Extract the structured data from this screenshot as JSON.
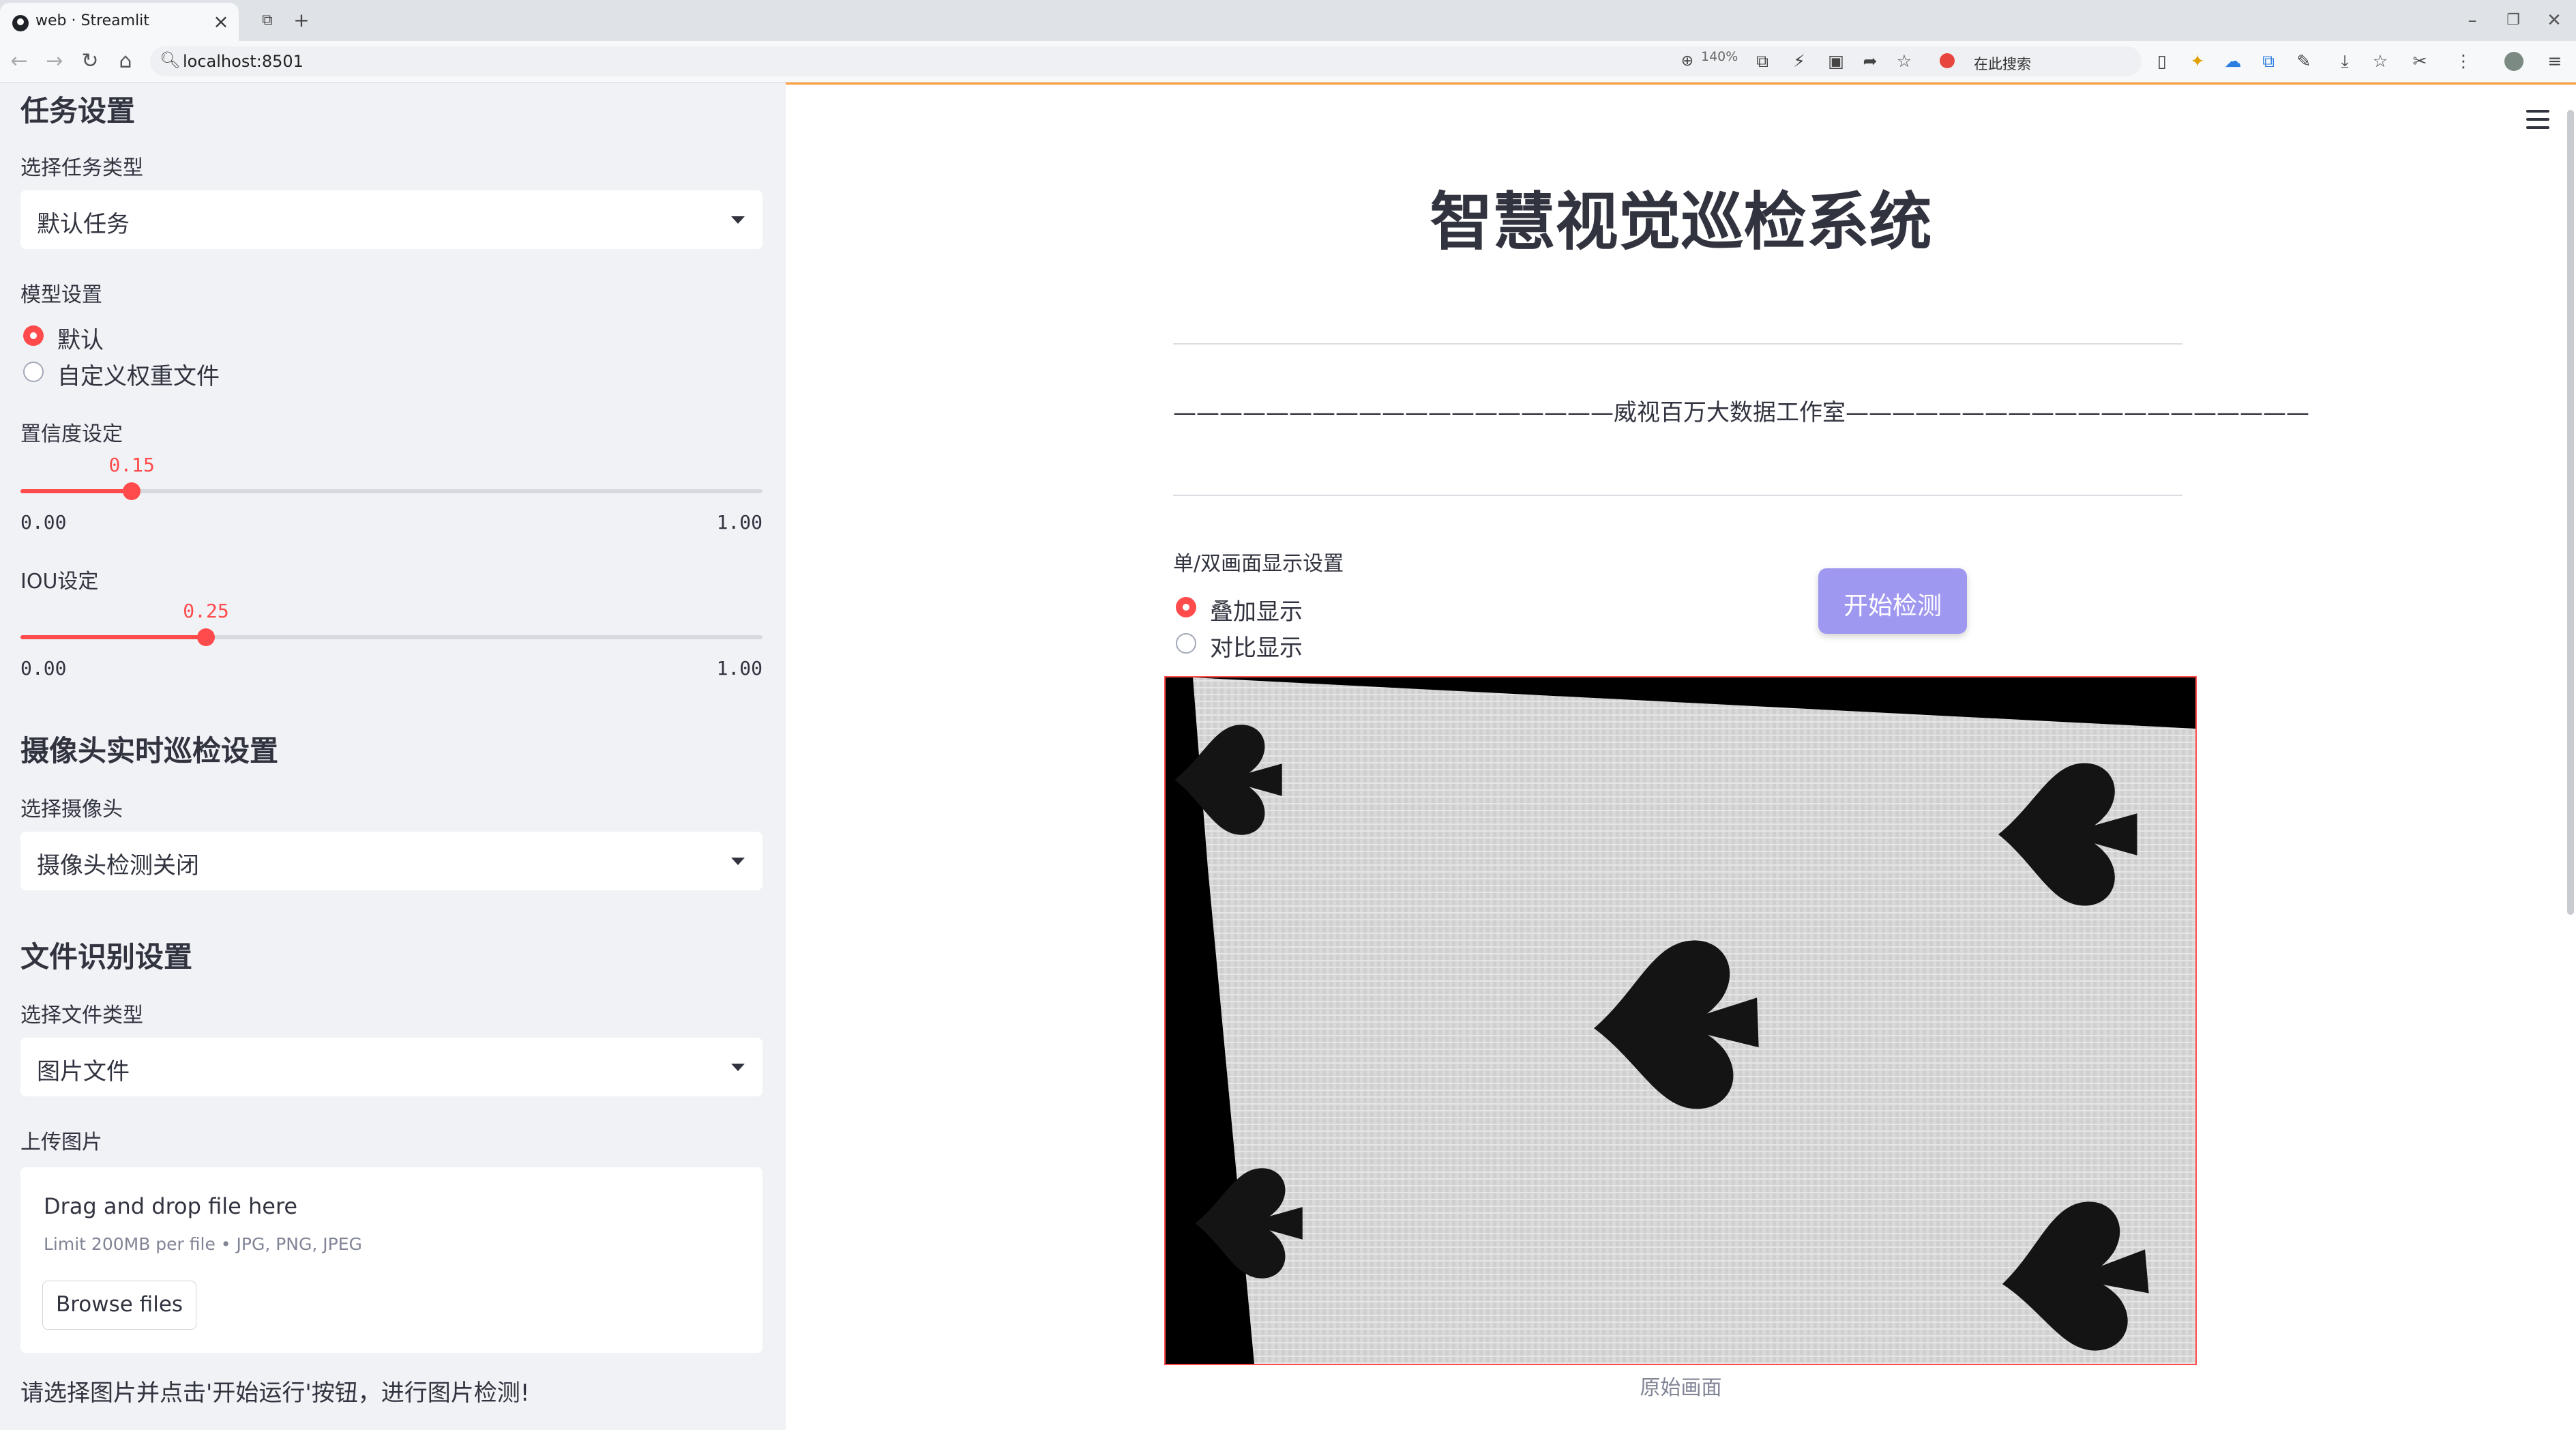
{
  "browser": {
    "tab_title": "web · Streamlit",
    "tab_close": "×",
    "new_tab": "+",
    "url": "localhost:8501",
    "zoom": "140%",
    "search_placeholder": "在此搜索"
  },
  "sidebar": {
    "task_header": "任务设置",
    "task_type_label": "选择任务类型",
    "task_type_value": "默认任务",
    "model_label": "模型设置",
    "model_options": [
      "默认",
      "自定义权重文件"
    ],
    "model_selected": "默认",
    "confidence": {
      "label": "置信度设定",
      "value": "0.15",
      "min": "0.00",
      "max": "1.00",
      "fraction": 0.15
    },
    "iou": {
      "label": "IOU设定",
      "value": "0.25",
      "min": "0.00",
      "max": "1.00",
      "fraction": 0.25
    },
    "camera_header": "摄像头实时巡检设置",
    "camera_label": "选择摄像头",
    "camera_value": "摄像头检测关闭",
    "file_header": "文件识别设置",
    "file_type_label": "选择文件类型",
    "file_type_value": "图片文件",
    "upload_label": "上传图片",
    "upload": {
      "title": "Drag and drop file here",
      "limit": "Limit 200MB per file • JPG, PNG, JPEG",
      "browse_label": "Browse files"
    },
    "footer_text": "请选择图片并点击'开始运行'按钮，进行图片检测!"
  },
  "main": {
    "title": "智慧视觉巡检系统",
    "subtitle": "———————————————————威视百万大数据工作室————————————————————",
    "display_label": "单/双画面显示设置",
    "display_options": [
      "叠加显示",
      "对比显示"
    ],
    "display_selected": "叠加显示",
    "start_button": "开始检测",
    "image_caption": "原始画面"
  },
  "colors": {
    "accent": "#ff4b4b",
    "sidebar_bg": "#f0f2f6",
    "primary_button": "#9f98f0",
    "top_decoration": "#ff9e3d"
  }
}
